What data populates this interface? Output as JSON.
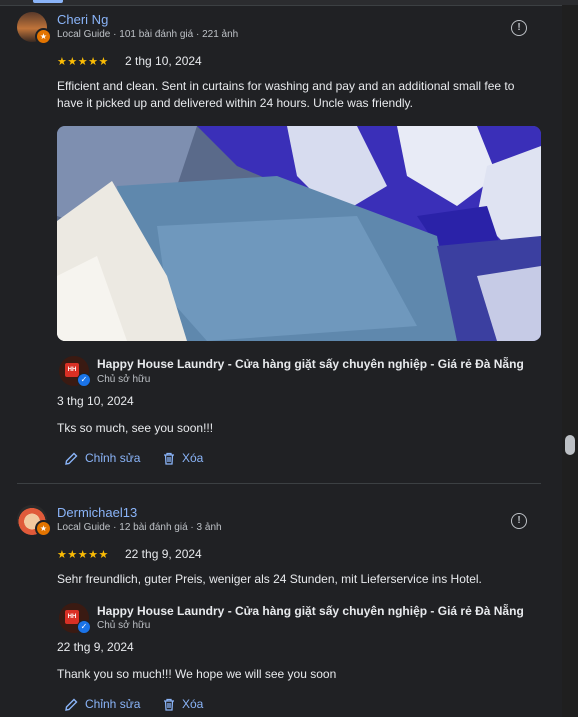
{
  "reviews": [
    {
      "author": "Cheri Ng",
      "meta": "Local Guide · 101 bài đánh giá · 221 ảnh",
      "stars": "★★★★★",
      "rating": 5,
      "date": "2 thg 10, 2024",
      "text": "Efficient and clean. Sent in curtains for washing and pay and an additional small fee to have it picked up and delivered within 24 hours. Uncle was friendly.",
      "reply": {
        "owner": "Happy House Laundry - Cửa hàng giặt sấy chuyên nghiệp - Giá rẻ Đà Nẵng",
        "role": "Chủ sở hữu",
        "date": "3 thg 10, 2024",
        "text": "Tks so much, see you soon!!!"
      },
      "actions": {
        "edit": "Chỉnh sửa",
        "delete": "Xóa"
      }
    },
    {
      "author": "Dermichael13",
      "meta": "Local Guide · 12 bài đánh giá · 3 ảnh",
      "stars": "★★★★★",
      "rating": 5,
      "date": "22 thg 9, 2024",
      "text": "Sehr freundlich, guter Preis, weniger als 24 Stunden, mit Lieferservice ins Hotel.",
      "reply": {
        "owner": "Happy House Laundry - Cửa hàng giặt sấy chuyên nghiệp - Giá rẻ Đà Nẵng",
        "role": "Chủ sở hữu",
        "date": "22 thg 9, 2024",
        "text": "Thank you so much!!! We hope we will see you soon"
      },
      "actions": {
        "edit": "Chỉnh sửa",
        "delete": "Xóa"
      }
    }
  ],
  "colors": {
    "background": "#202124",
    "link": "#8ab4f8",
    "star": "#fbbc04",
    "text": "#e8eaed",
    "muted": "#bdc1c6"
  },
  "icons": {
    "more": "info-circle-icon",
    "edit": "pencil-icon",
    "delete": "trash-icon",
    "verified": "check-badge-icon"
  }
}
